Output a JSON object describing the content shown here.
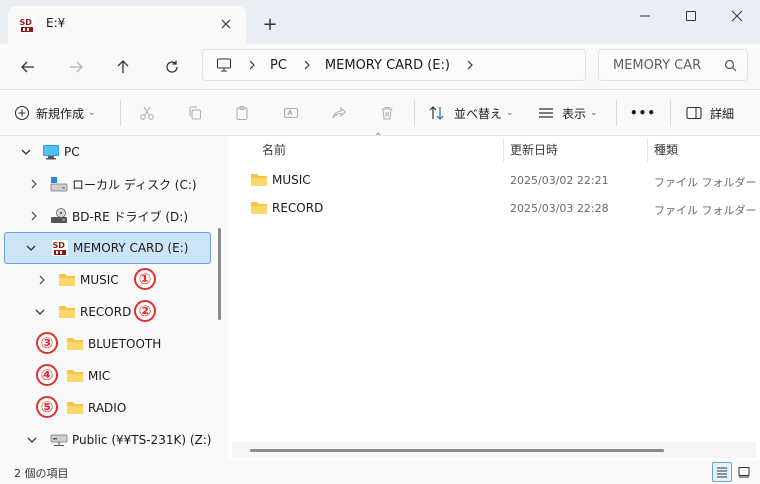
{
  "window": {
    "tab_title": "E:¥",
    "new_tab_label": "+"
  },
  "addressbar": {
    "items": [
      "PC",
      "MEMORY CARD (E:)"
    ]
  },
  "search": {
    "placeholder": "MEMORY CAR"
  },
  "toolbar": {
    "new_label": "新規作成",
    "sort_label": "並べ替え",
    "view_label": "表示",
    "more_label": "•••",
    "details_label": "詳細"
  },
  "sidebar": {
    "items": [
      {
        "label": "PC",
        "icon": "monitor-icon"
      },
      {
        "label": "ローカル ディスク (C:)",
        "icon": "drive-icon"
      },
      {
        "label": "BD-RE ドライブ (D:)",
        "icon": "bd-drive-icon"
      },
      {
        "label": "MEMORY CARD (E:)",
        "icon": "sd-card-icon"
      },
      {
        "label": "MUSIC",
        "icon": "folder-icon"
      },
      {
        "label": "RECORD",
        "icon": "folder-icon"
      },
      {
        "label": "BLUETOOTH",
        "icon": "folder-icon"
      },
      {
        "label": "MIC",
        "icon": "folder-icon"
      },
      {
        "label": "RADIO",
        "icon": "folder-icon"
      },
      {
        "label": "Public (¥¥TS-231K) (Z:)",
        "icon": "network-drive-icon"
      }
    ],
    "annotations": [
      "①",
      "②",
      "③",
      "④",
      "⑤"
    ]
  },
  "content": {
    "columns": [
      "名前",
      "更新日時",
      "種類"
    ],
    "rows": [
      {
        "name": "MUSIC",
        "date": "2025/03/02 22:21",
        "type": "ファイル フォルダー"
      },
      {
        "name": "RECORD",
        "date": "2025/03/03 22:28",
        "type": "ファイル フォルダー"
      }
    ]
  },
  "status": {
    "text": "2 個の項目"
  },
  "colors": {
    "folder": "#f6c343",
    "selection": "#cce4f7",
    "annotation": "#e03030"
  }
}
